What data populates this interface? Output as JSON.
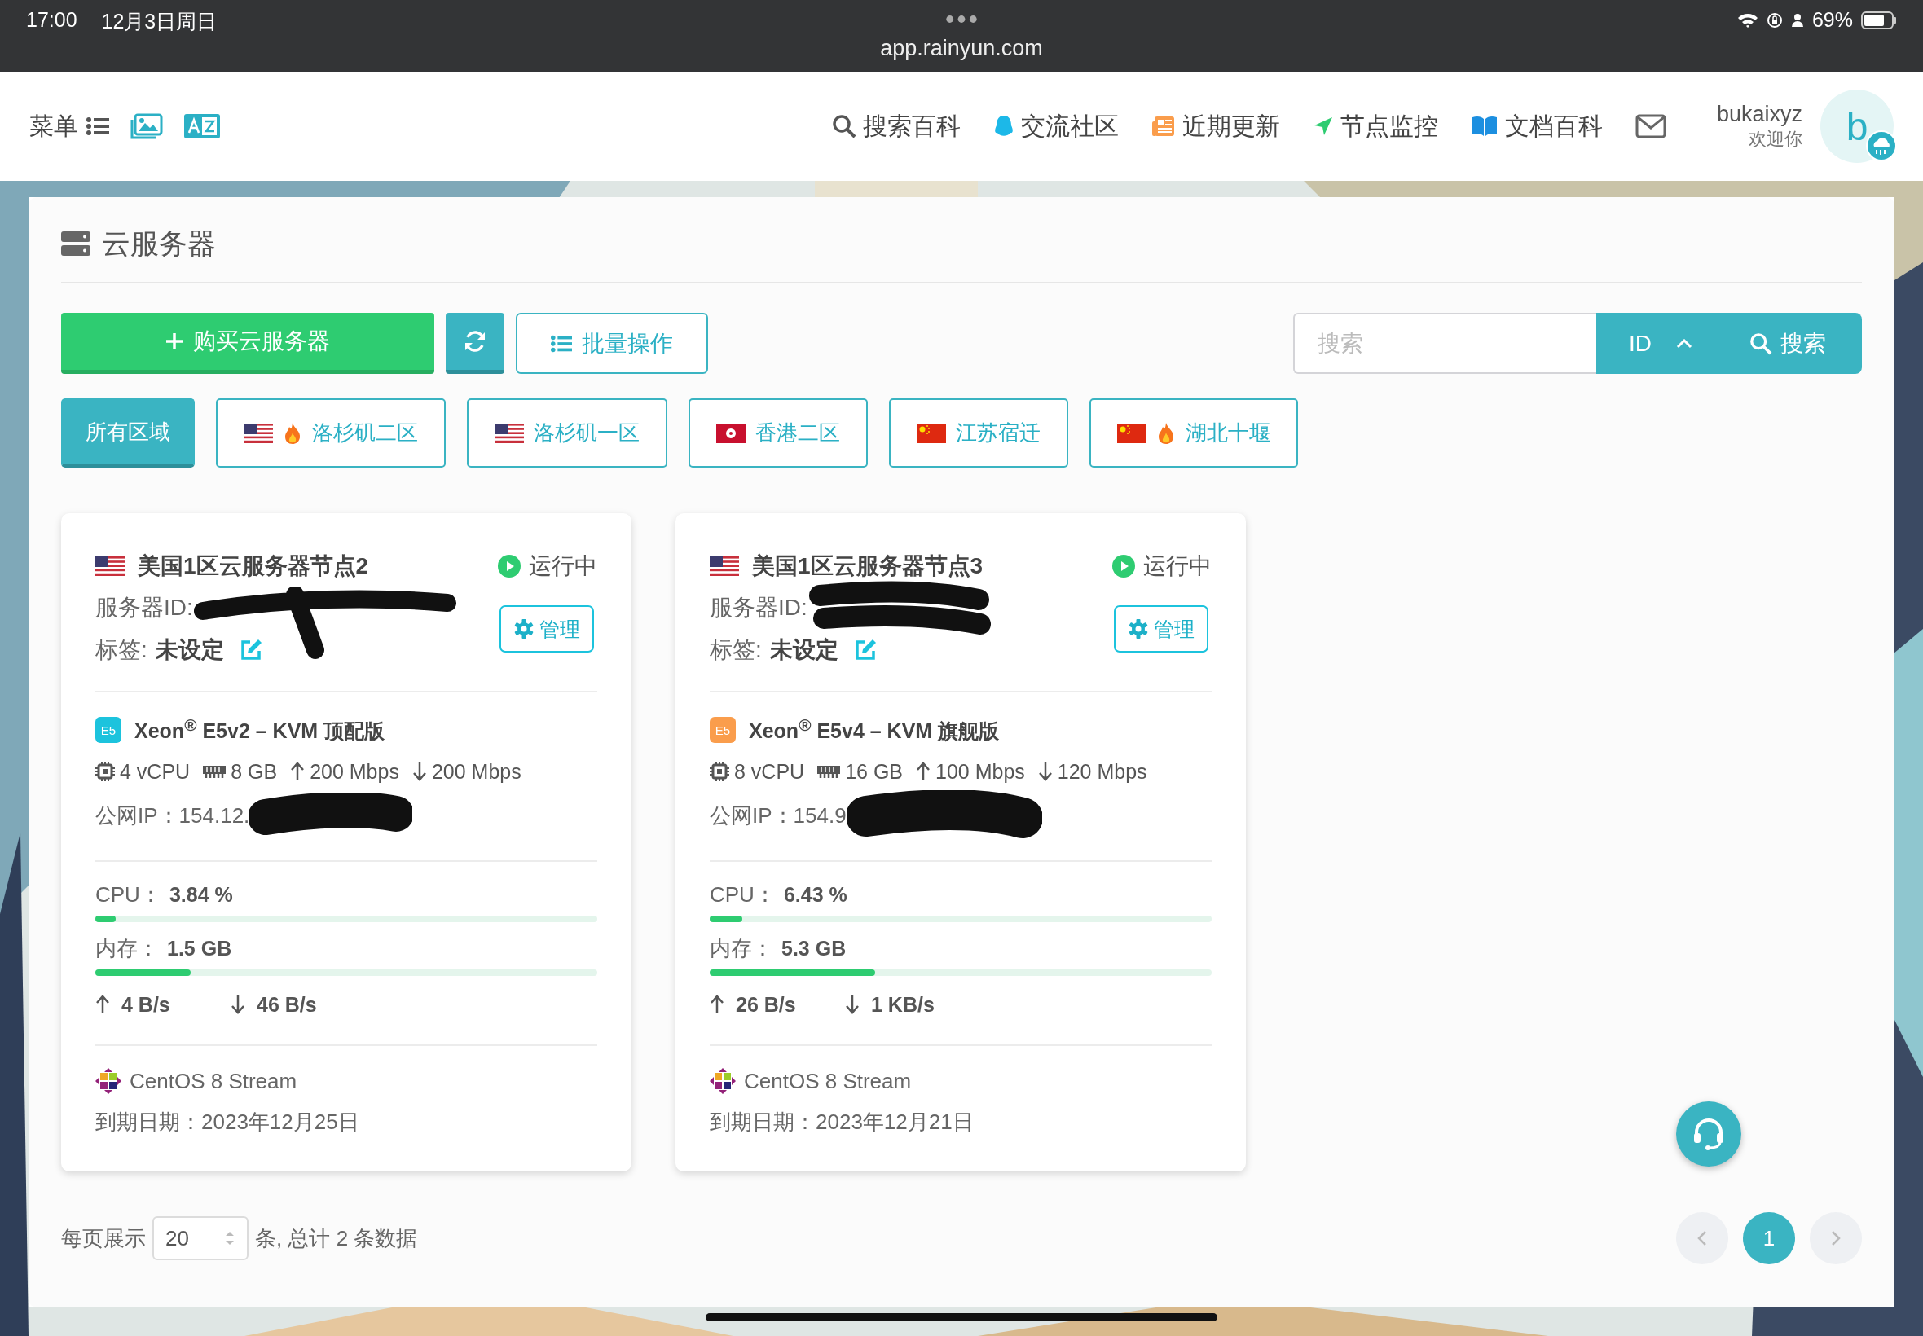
{
  "status_bar": {
    "time": "17:00",
    "date": "12月3日周日",
    "url": "app.rainyun.com",
    "battery": "69%"
  },
  "nav": {
    "menu_label": "菜单",
    "links": [
      {
        "kind": "search",
        "label": "搜索百科"
      },
      {
        "kind": "chat",
        "label": "交流社区"
      },
      {
        "kind": "news",
        "label": "近期更新"
      },
      {
        "kind": "send",
        "label": "节点监控"
      },
      {
        "kind": "book",
        "label": "文档百科"
      }
    ],
    "user_name": "bukaixyz",
    "greeting": "欢迎你",
    "avatar_letter": "b"
  },
  "page": {
    "title": "云服务器",
    "buy_button": "购买云服务器",
    "batch_button": "批量操作",
    "search_placeholder": "搜索",
    "sort_field": "ID",
    "search_button": "搜索"
  },
  "regions": [
    {
      "label": "所有区域",
      "selected": true,
      "hot": false
    },
    {
      "label": "洛杉矶二区",
      "flag": {
        "kind": "us"
      },
      "hot": true,
      "selected": false
    },
    {
      "label": "洛杉矶一区",
      "flag": {
        "kind": "us"
      },
      "hot": false,
      "selected": false
    },
    {
      "label": "香港二区",
      "flag": {
        "kind": "hk"
      },
      "hot": false,
      "selected": false
    },
    {
      "label": "江苏宿迁",
      "flag": {
        "kind": "cn"
      },
      "hot": false,
      "selected": false
    },
    {
      "label": "湖北十堰",
      "flag": {
        "kind": "cn"
      },
      "hot": true,
      "selected": false
    }
  ],
  "servers": [
    {
      "flag": {
        "kind": "us"
      },
      "name": "美国1区云服务器节点2",
      "status": "运行中",
      "id_label": "服务器ID:",
      "tag_label": "标签:",
      "tag_value": "未设定",
      "manage": "管理",
      "badge": {
        "text": "E5",
        "color": "#1cc3dd"
      },
      "plan": "Xeon$^{®}$ E5v2 – KVM 顶配版",
      "vcpu": "4 vCPU",
      "ram": "8 GB",
      "bw_up": "200 Mbps",
      "bw_down": "200 Mbps",
      "ip_label": "公网IP：",
      "ip": "154.12.",
      "cpu": {
        "label": "CPU：",
        "value": "3.84 %",
        "level": 0.04
      },
      "memory": {
        "label": "内存：",
        "value": "1.5 GB",
        "level": 0.19
      },
      "net_up": "4 B/s",
      "net_down": "46 B/s",
      "os": "CentOS 8 Stream",
      "expiry_label": "到期日期：",
      "expiry": "2023年12月25日",
      "redacted": true
    },
    {
      "flag": {
        "kind": "us"
      },
      "name": "美国1区云服务器节点3",
      "status": "运行中",
      "id_label": "服务器ID:",
      "tag_label": "标签:",
      "tag_value": "未设定",
      "manage": "管理",
      "badge": {
        "text": "E5",
        "color": "#fa9d4c"
      },
      "plan": "Xeon$^{®}$ E5v4 – KVM 旗舰版",
      "vcpu": "8 vCPU",
      "ram": "16 GB",
      "bw_up": "100 Mbps",
      "bw_down": "120 Mbps",
      "ip_label": "公网IP：",
      "ip": "154.9",
      "cpu": {
        "label": "CPU：",
        "value": "6.43 %",
        "level": 0.065
      },
      "memory": {
        "label": "内存：",
        "value": "5.3 GB",
        "level": 0.33
      },
      "net_up": "26 B/s",
      "net_down": "1 KB/s",
      "os": "CentOS 8 Stream",
      "expiry_label": "到期日期：",
      "expiry": "2023年12月21日",
      "redacted": true
    }
  ],
  "pagination": {
    "per_page_label": "每页展示",
    "page_size": "20",
    "total": "条, 总计 2 条数据",
    "pages": [
      {
        "label": "1",
        "selected": true
      }
    ]
  }
}
